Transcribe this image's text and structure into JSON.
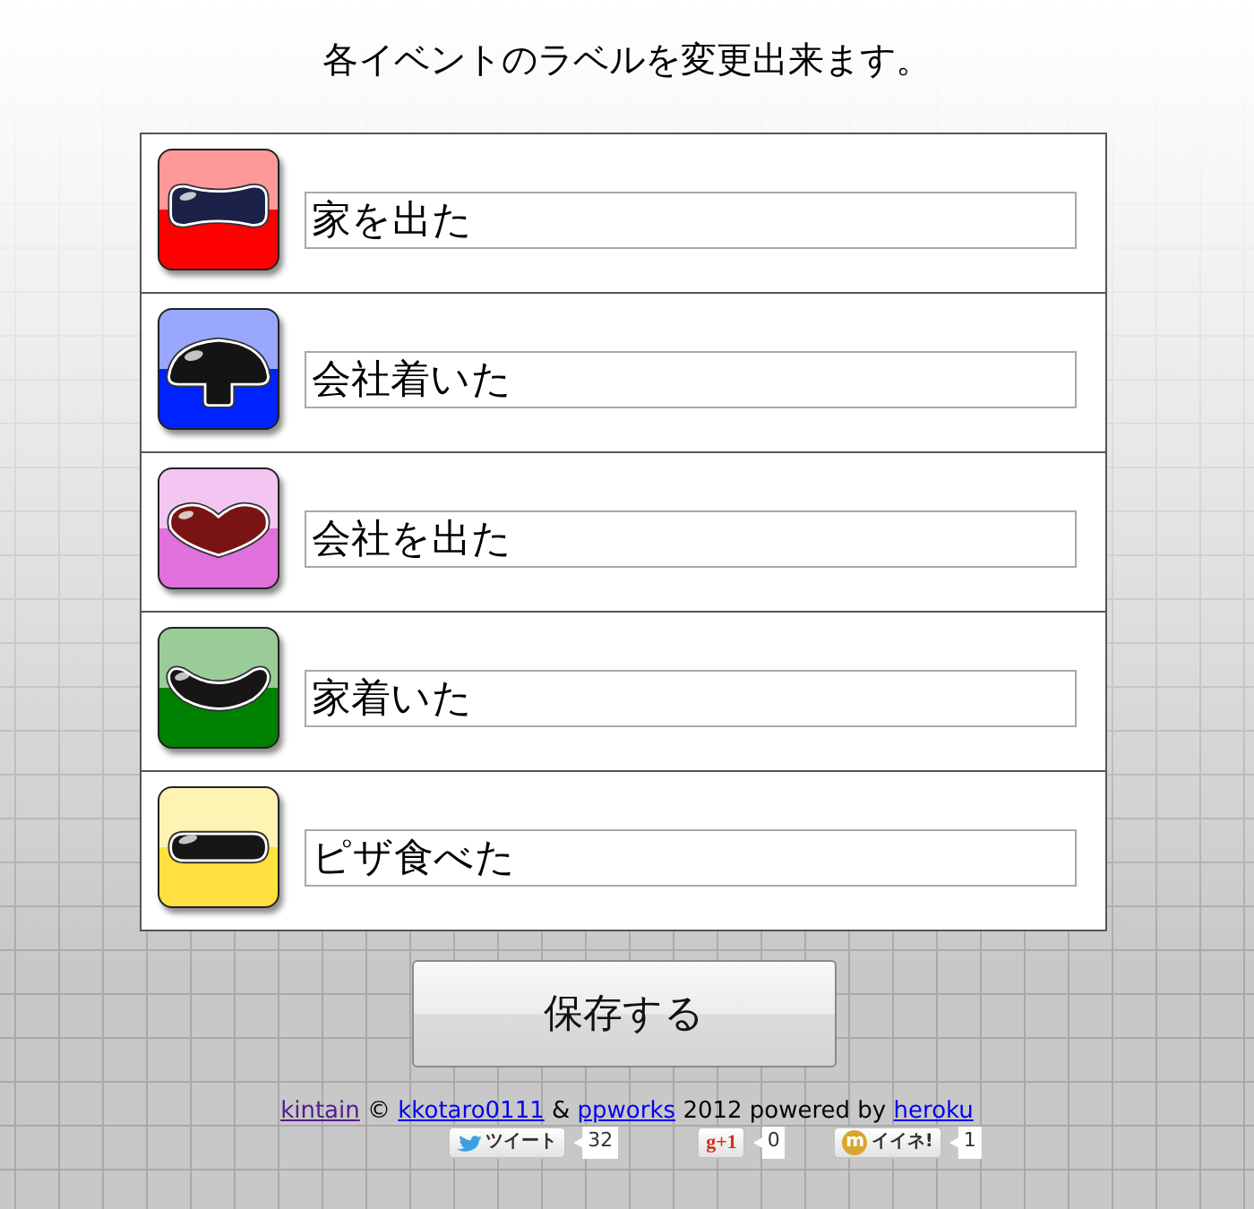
{
  "title": "各イベントのラベルを変更出来ます。",
  "events": [
    {
      "kind": "bone",
      "color": "#ff0000",
      "label": "家を出た"
    },
    {
      "kind": "mushroom",
      "color": "#0022ff",
      "label": "会社着いた"
    },
    {
      "kind": "heart",
      "color": "#e070dc",
      "label": "会社を出た"
    },
    {
      "kind": "curve",
      "color": "#008000",
      "label": "家着いた"
    },
    {
      "kind": "pill",
      "color": "#ffe040",
      "label": "ピザ食べた"
    }
  ],
  "save_button": "保存する",
  "footer": {
    "credits": [
      {
        "kind": "link",
        "text": "kintain",
        "visited": true
      },
      {
        "kind": "text",
        "text": "©"
      },
      {
        "kind": "link",
        "text": "kkotaro0111",
        "visited": false
      },
      {
        "kind": "text",
        "text": "&"
      },
      {
        "kind": "link",
        "text": "ppworks",
        "visited": false
      },
      {
        "kind": "text",
        "text": "2012 powered by"
      },
      {
        "kind": "link",
        "text": "heroku",
        "visited": false
      }
    ],
    "social": [
      {
        "kind": "tweet",
        "label": "ツイート",
        "count": "32"
      },
      {
        "kind": "plusone",
        "label": "g+1",
        "count": "0"
      },
      {
        "kind": "like",
        "icon_text": "m",
        "label": "イイネ!",
        "count": "1"
      }
    ]
  }
}
